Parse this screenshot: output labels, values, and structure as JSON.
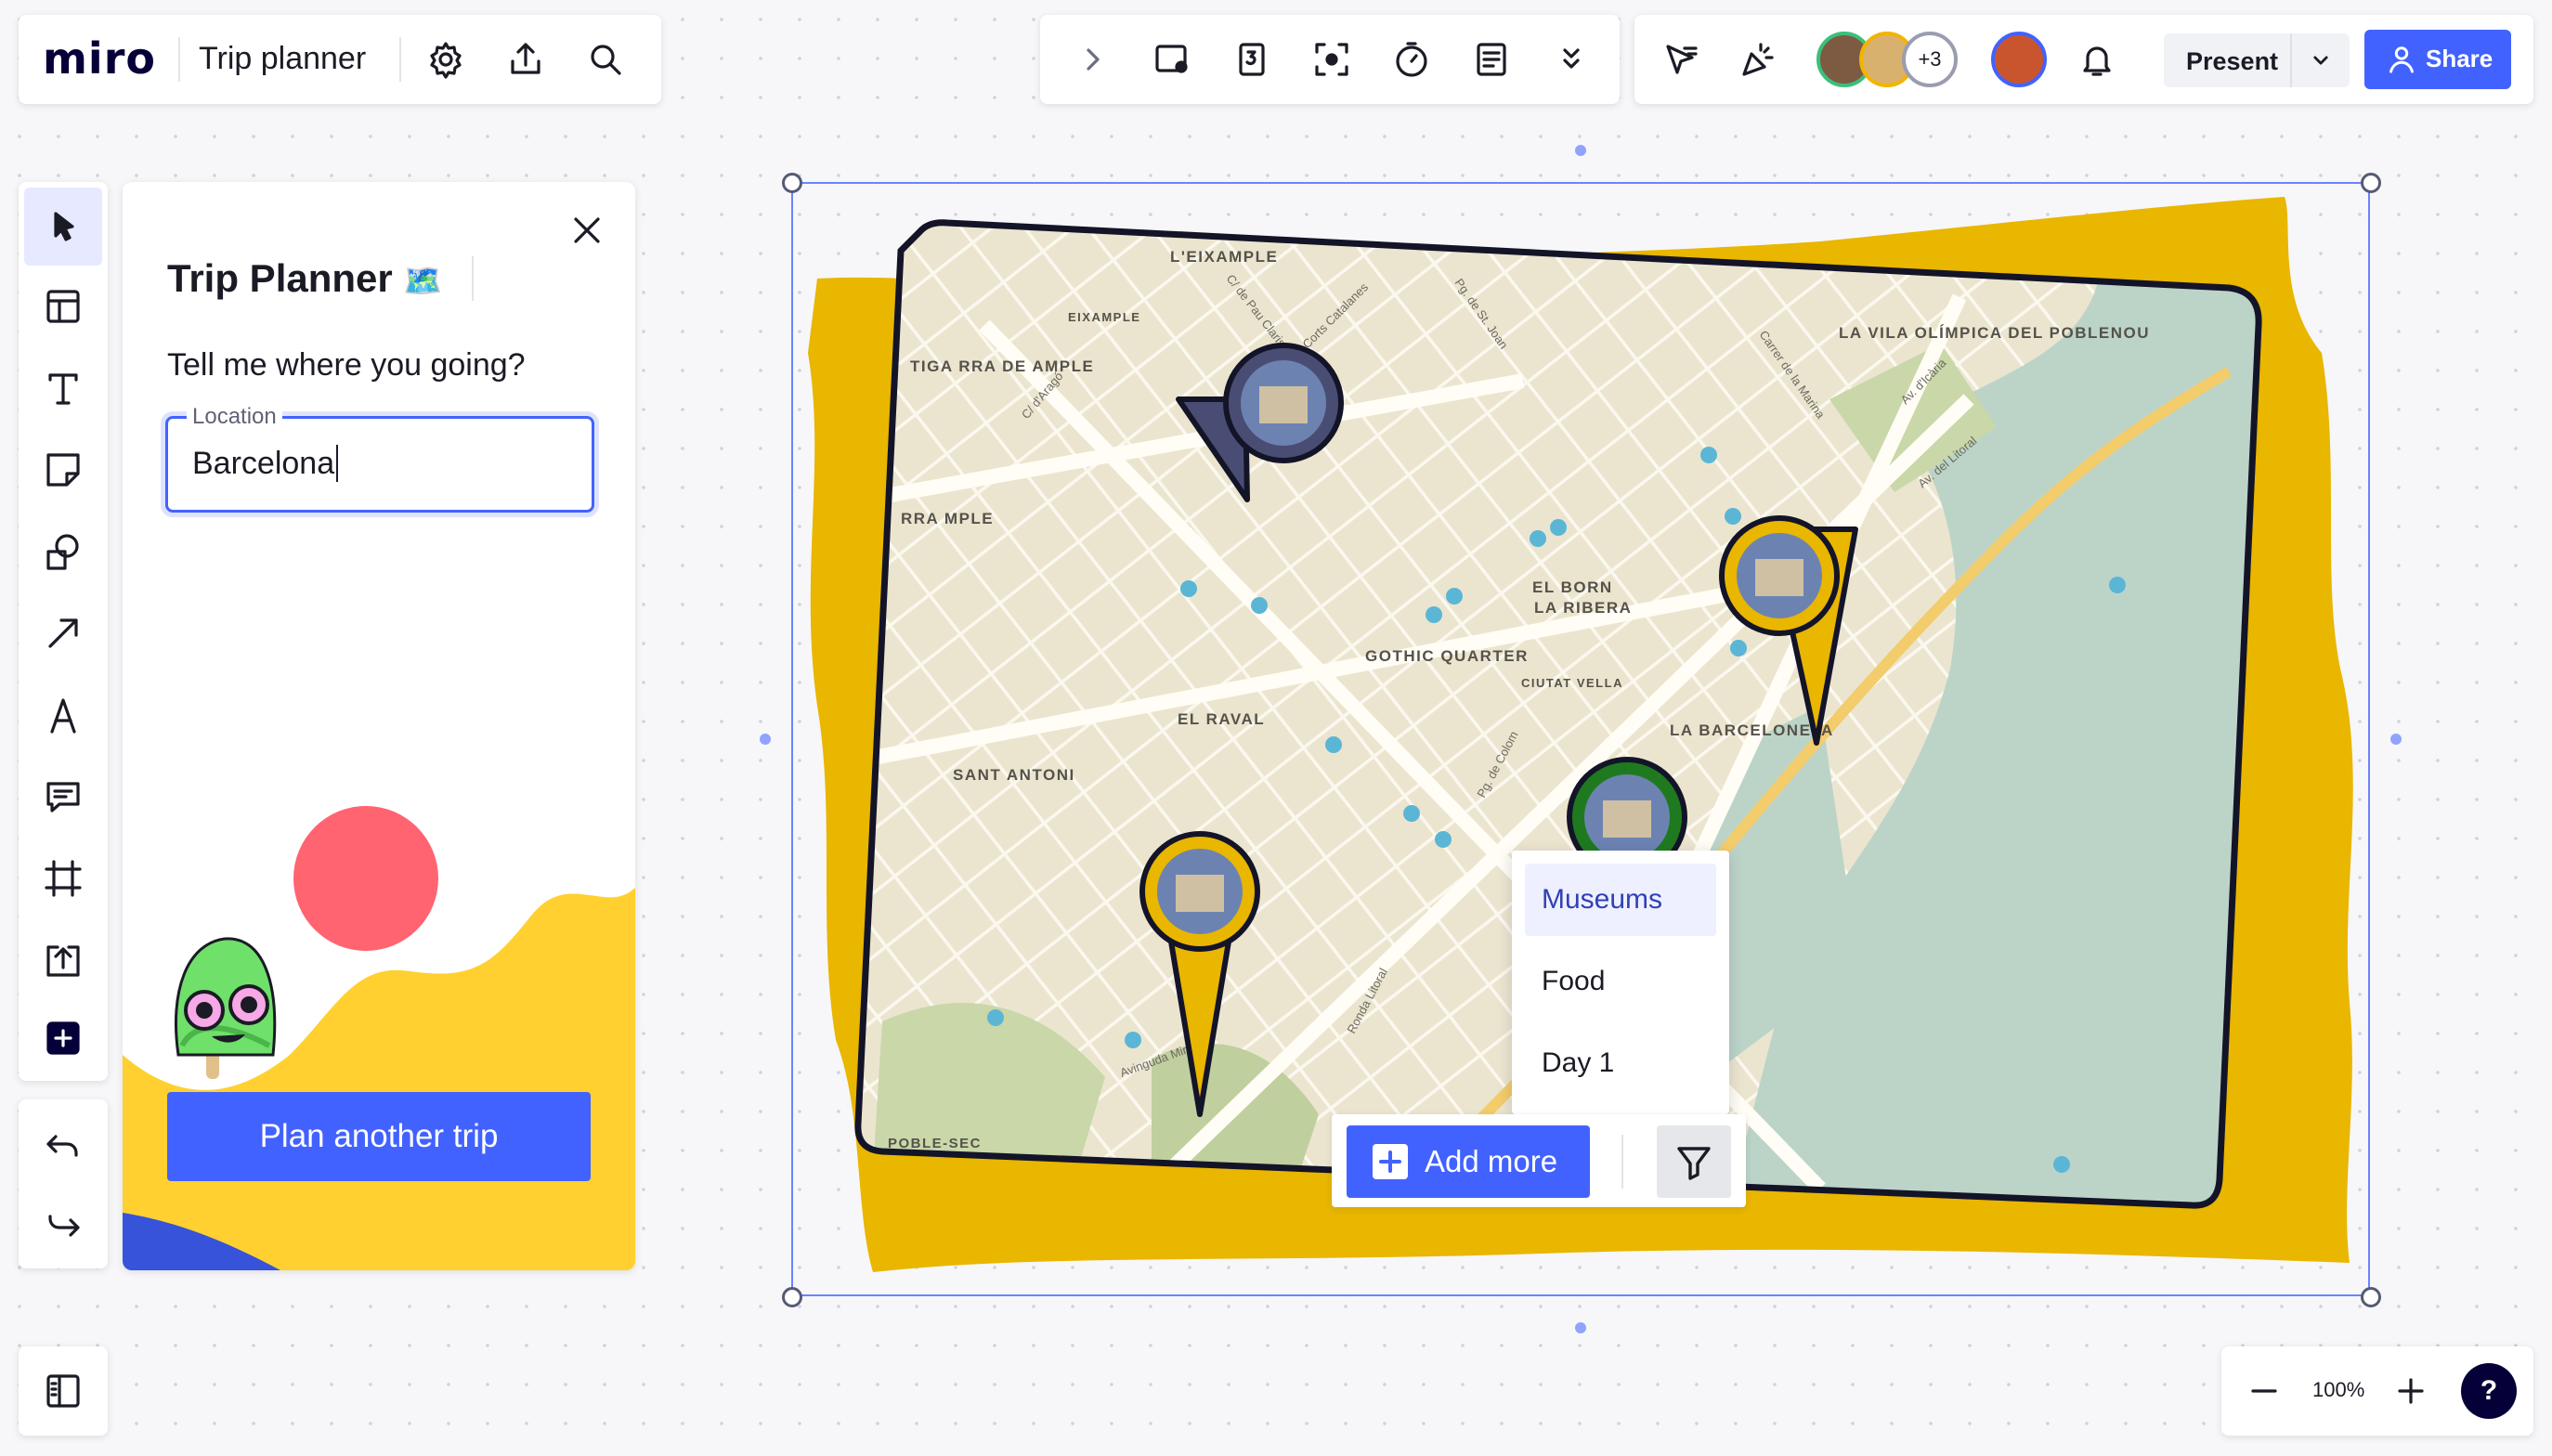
{
  "app": {
    "logo": "miro",
    "board_title": "Trip planner"
  },
  "collaborators": {
    "extra_count": "+3"
  },
  "header": {
    "present_label": "Present",
    "share_label": "Share"
  },
  "panel": {
    "title": "Trip Planner",
    "title_emoji": "🗺️",
    "question": "Tell me where you going?",
    "location_label": "Location",
    "location_value": "Barcelona",
    "cta_label": "Plan another trip"
  },
  "map": {
    "place_labels": [
      "L'EIXAMPLE",
      "EIXAMPLE",
      "TIGA RRA DE AMPLE",
      "RRA MPLE",
      "LA VILA OLÍMPICA DEL POBLENOU",
      "EL BORN",
      "LA RIBERA",
      "GOTHIC QUARTER",
      "CIUTAT VELLA",
      "EL RAVAL",
      "SANT ANTONI",
      "LA BARCELONETA",
      "POBLE-SEC"
    ],
    "street_labels": [
      "C/ de Pau Claris",
      "Corts Catalanes",
      "Pg. de St. Joan",
      "Carrer de la Marina",
      "Av. d'Icària",
      "Av. del Litoral",
      "Pg. de Colom",
      "Ronda Litoral",
      "Avinguda Miramar",
      "C/ d'Aragó"
    ]
  },
  "dropdown": {
    "items": [
      "Museums",
      "Food",
      "Day 1"
    ],
    "selected": "Museums"
  },
  "actions": {
    "add_more_label": "Add more"
  },
  "zoom": {
    "level": "100%",
    "help_label": "?"
  },
  "colors": {
    "accent": "#4262ff",
    "map_frame": "#e9b600",
    "pin_navy": "#4a4d73",
    "pin_yellow": "#e9b600",
    "pin_green": "#1f7a1f",
    "sun": "#ff6470"
  }
}
